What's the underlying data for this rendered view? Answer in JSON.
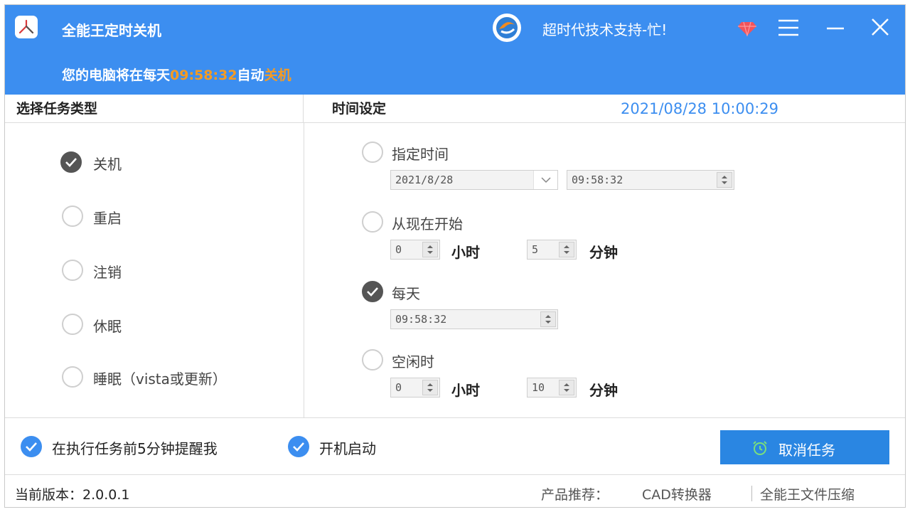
{
  "app": {
    "title": "全能王定时关机",
    "support_text": "超时代技术支持-忙!",
    "schedule_prefix": "您的电脑将在每天",
    "schedule_time": "09:58:32",
    "schedule_mid": "自动",
    "schedule_action": "关机"
  },
  "left_panel": {
    "header": "选择任务类型",
    "tasks": [
      {
        "label": "关机",
        "checked": true
      },
      {
        "label": "重启",
        "checked": false
      },
      {
        "label": "注销",
        "checked": false
      },
      {
        "label": "休眠",
        "checked": false
      },
      {
        "label": "睡眠（vista或更新）",
        "checked": false
      }
    ]
  },
  "right_panel": {
    "header": "时间设定",
    "current_datetime": "2021/08/28 10:00:29",
    "specific_time": {
      "label": "指定时间",
      "date": "2021/8/28",
      "time": "09:58:32"
    },
    "from_now": {
      "label": "从现在开始",
      "hours": "0",
      "hours_unit": "小时",
      "minutes": "5",
      "minutes_unit": "分钟"
    },
    "daily": {
      "label": "每天",
      "time": "09:58:32"
    },
    "idle": {
      "label": "空闲时",
      "hours": "0",
      "hours_unit": "小时",
      "minutes": "10",
      "minutes_unit": "分钟"
    }
  },
  "options": {
    "remind": "在执行任务前5分钟提醒我",
    "autostart": "开机启动"
  },
  "cancel_button": "取消任务",
  "footer": {
    "version": "当前版本：2.0.0.1",
    "recommend": "产品推荐：",
    "link1": "CAD转换器",
    "link2": "全能王文件压缩"
  },
  "colors": {
    "accent": "#3c8ef0",
    "highlight": "#f59b23",
    "button": "#2a86e2"
  }
}
